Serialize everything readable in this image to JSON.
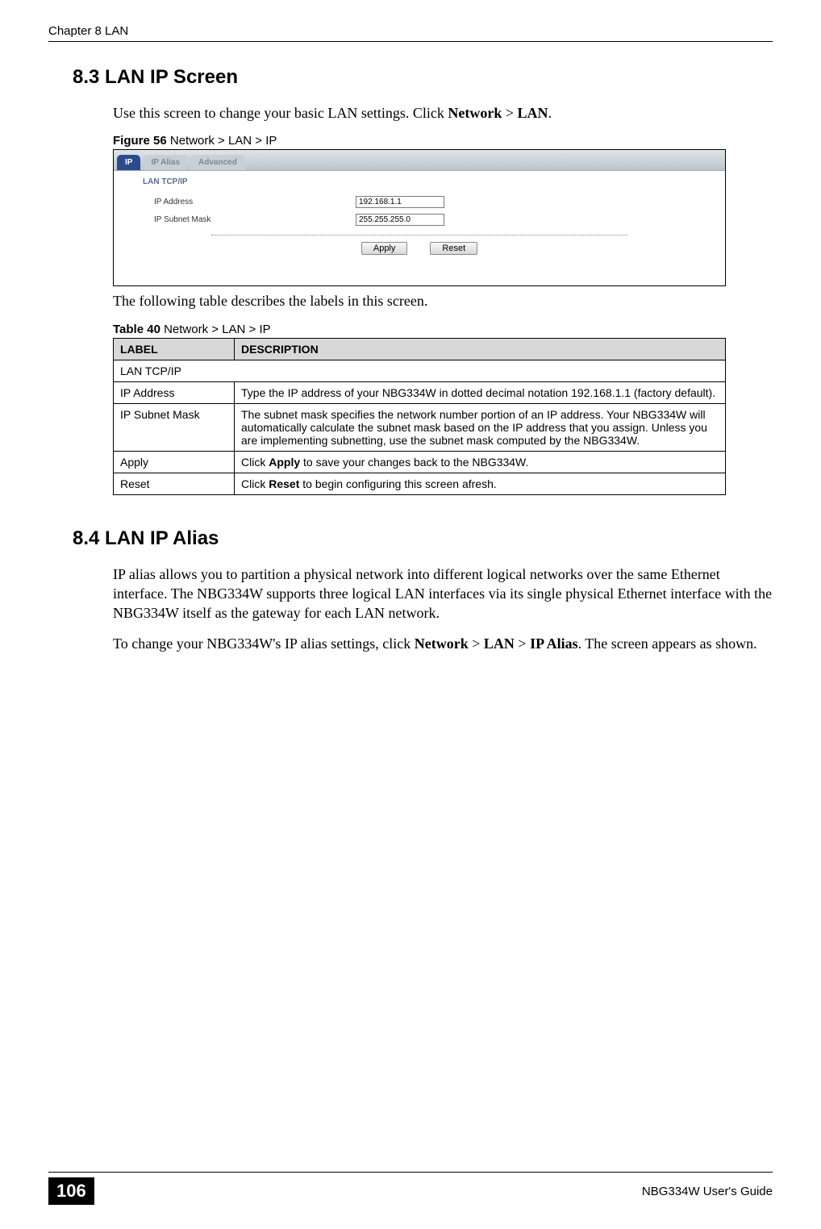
{
  "header": {
    "left": "Chapter 8 LAN",
    "right": ""
  },
  "section83": {
    "heading": "8.3  LAN IP Screen",
    "intro_pre": "Use this screen to change your basic LAN settings. Click ",
    "intro_b1": "Network",
    "intro_gt": " > ",
    "intro_b2": "LAN",
    "intro_post": "."
  },
  "figure": {
    "num": "Figure 56",
    "title": "   Network > LAN > IP",
    "tabs": {
      "active": "IP",
      "inactive1": "IP Alias",
      "inactive2": "Advanced"
    },
    "panel_title": "LAN TCP/IP",
    "row1_label": "IP Address",
    "row1_value": "192.168.1.1",
    "row2_label": "IP Subnet Mask",
    "row2_value": "255.255.255.0",
    "btn_apply": "Apply",
    "btn_reset": "Reset"
  },
  "after_fig": "The following table describes the labels in this screen.",
  "table": {
    "num": "Table 40",
    "title": "   Network > LAN > IP",
    "head_label": "LABEL",
    "head_desc": "DESCRIPTION",
    "r1_label": "LAN TCP/IP",
    "r1_desc": "",
    "r2_label": "IP Address",
    "r2_desc": "Type the IP address of your NBG334W in dotted decimal notation 192.168.1.1 (factory default).",
    "r3_label": "IP Subnet Mask",
    "r3_desc": "The subnet mask specifies the network number portion of an IP address. Your NBG334W will automatically calculate the subnet mask based on the IP address that you assign. Unless you are implementing subnetting, use the subnet mask computed by the NBG334W.",
    "r4_label": "Apply",
    "r4_desc_pre": "Click ",
    "r4_desc_b": "Apply",
    "r4_desc_post": " to save your changes back to the NBG334W.",
    "r5_label": "Reset",
    "r5_desc_pre": "Click ",
    "r5_desc_b": "Reset",
    "r5_desc_post": " to begin configuring this screen afresh."
  },
  "section84": {
    "heading": "8.4  LAN IP Alias",
    "p1": "IP alias allows you to partition a physical network into different logical networks over the same Ethernet interface. The NBG334W supports three logical LAN interfaces via its single physical Ethernet interface with the NBG334W itself as the gateway for each LAN network.",
    "p2_pre": "To change your NBG334W's IP alias settings, click ",
    "p2_b1": "Network",
    "p2_gt1": " > ",
    "p2_b2": "LAN",
    "p2_gt2": " > ",
    "p2_b3": "IP Alias",
    "p2_post": ". The screen appears as shown."
  },
  "footer": {
    "page": "106",
    "guide": "NBG334W User's Guide"
  }
}
